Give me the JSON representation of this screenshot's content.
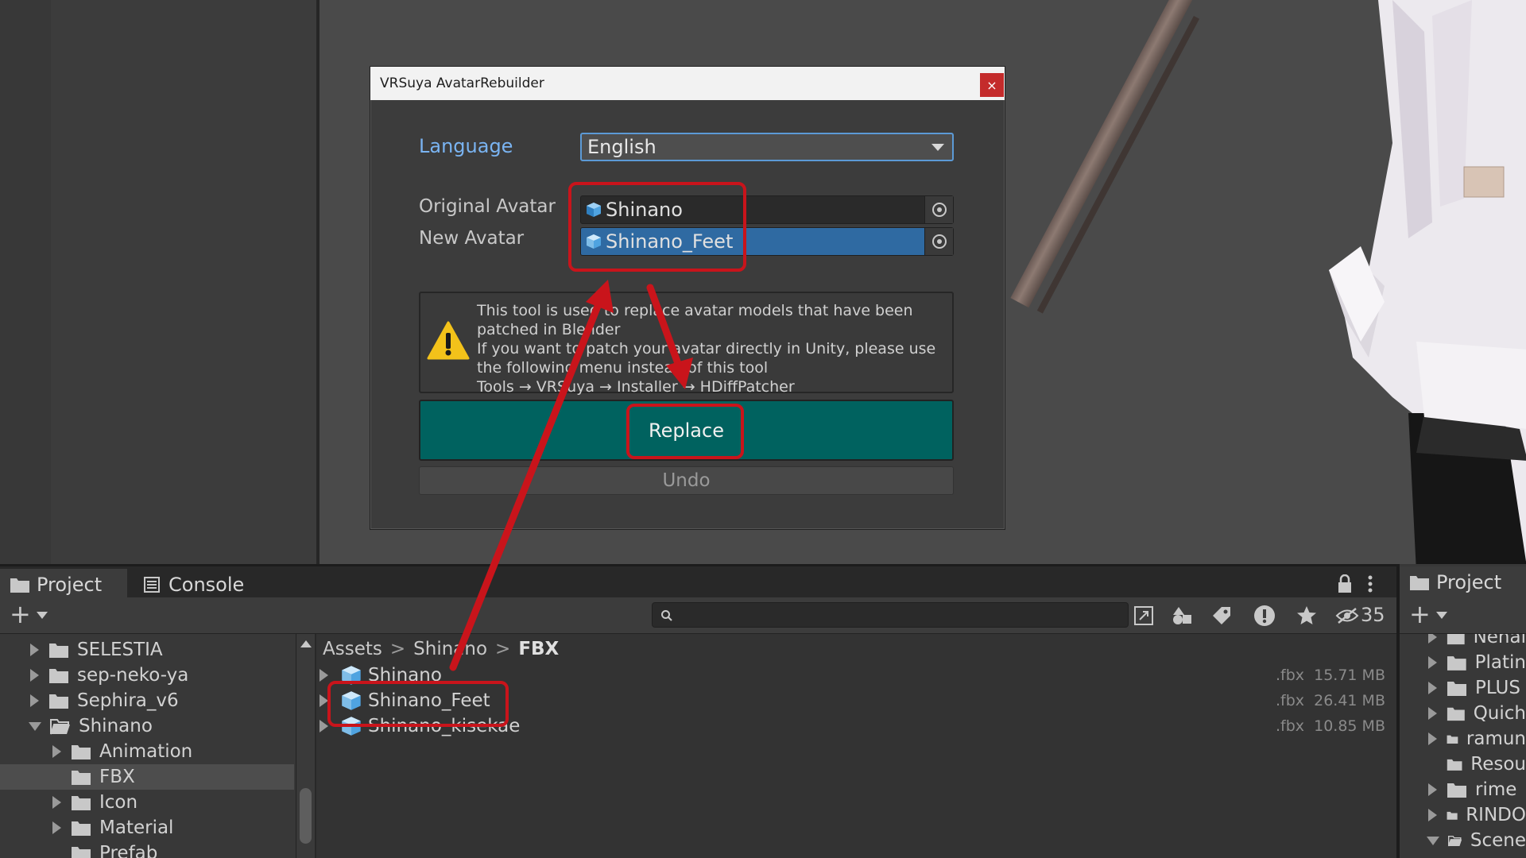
{
  "dialog": {
    "title": "VRSuya AvatarRebuilder",
    "close_label": "×",
    "language_label": "Language",
    "language_value": "English",
    "original_label": "Original Avatar",
    "original_value": "Shinano",
    "new_label": "New Avatar",
    "new_value": "Shinano_Feet",
    "help_text": "This tool is used to replace avatar models that have been\npatched in Blender\nIf you want to patch your avatar directly in Unity, please use\nthe following menu instead of this tool\nTools → VRSuya → Installer → HDiffPatcher",
    "replace_label": "Replace",
    "undo_label": "Undo"
  },
  "project_panel": {
    "tabs": [
      {
        "label": "Project"
      },
      {
        "label": "Console"
      }
    ],
    "add_label": "+",
    "hidden_count": "35",
    "tree": [
      {
        "label": "SELESTIA",
        "level": 1,
        "expanded": false
      },
      {
        "label": "sep-neko-ya",
        "level": 1,
        "expanded": false
      },
      {
        "label": "Sephira_v6",
        "level": 1,
        "expanded": false
      },
      {
        "label": "Shinano",
        "level": 1,
        "expanded": true
      },
      {
        "label": "Animation",
        "level": 2,
        "expanded": false
      },
      {
        "label": "FBX",
        "level": 2,
        "expanded": false,
        "selected": true
      },
      {
        "label": "Icon",
        "level": 2,
        "expanded": false
      },
      {
        "label": "Material",
        "level": 2,
        "expanded": false
      },
      {
        "label": "Prefab",
        "level": 2,
        "expanded": false
      }
    ],
    "breadcrumb": [
      "Assets",
      "Shinano",
      "FBX"
    ],
    "files": [
      {
        "name": "Shinano",
        "ext": ".fbx",
        "size": "15.71 MB"
      },
      {
        "name": "Shinano_Feet",
        "ext": ".fbx",
        "size": "26.41 MB"
      },
      {
        "name": "Shinano_kisekae",
        "ext": ".fbx",
        "size": "10.85 MB"
      }
    ]
  },
  "right_panel": {
    "tab_label": "Project",
    "items": [
      "Nehal",
      "Platin",
      "PLUS",
      "Quich",
      "ramun",
      "Resou",
      "rime",
      "RINDO",
      "Scene"
    ]
  },
  "colors": {
    "accent": "#5c9ad6",
    "replace_button": "#00625f",
    "annotation_red": "#c9141b",
    "selected_field": "#2f6aa2"
  }
}
